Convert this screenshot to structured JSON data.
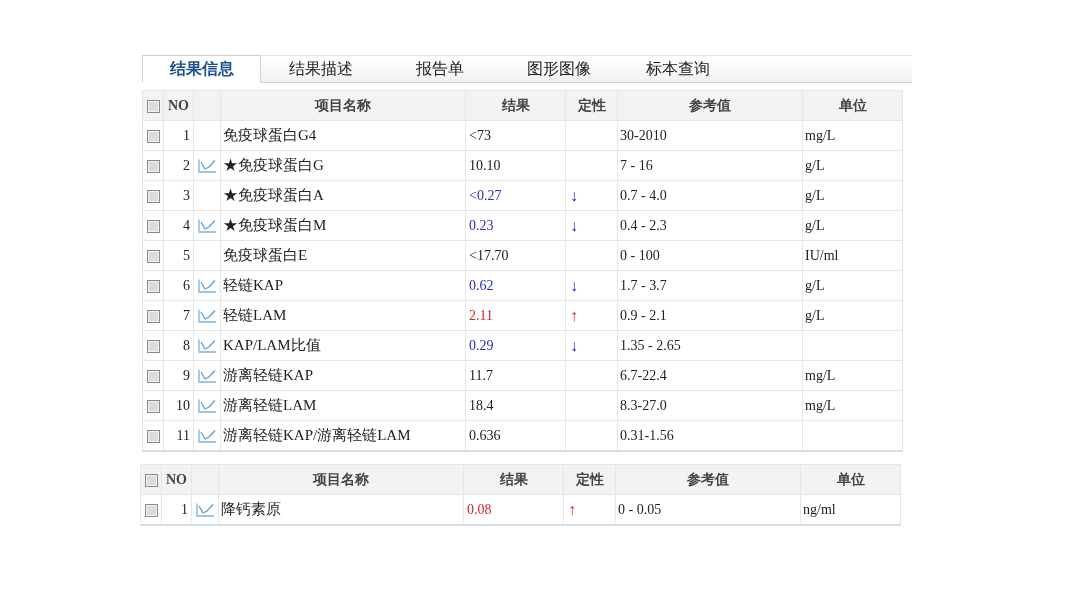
{
  "tabs": [
    {
      "label": "结果信息",
      "selected": true
    },
    {
      "label": "结果描述",
      "selected": false
    },
    {
      "label": "报告单",
      "selected": false
    },
    {
      "label": "图形图像",
      "selected": false
    },
    {
      "label": "标本查询",
      "selected": false
    }
  ],
  "tables": [
    {
      "header_checked": false,
      "columns": [
        "NO",
        "项目名称",
        "结果",
        "定性",
        "参考值",
        "单位"
      ],
      "rows": [
        {
          "checked": false,
          "no": "1",
          "trend_icon": false,
          "name": "免疫球蛋白G4",
          "result": "<73",
          "low": false,
          "high": false,
          "reference": "30-2010",
          "unit": "mg/L"
        },
        {
          "checked": false,
          "no": "2",
          "trend_icon": true,
          "name": "★免疫球蛋白G",
          "result": "10.10",
          "low": false,
          "high": false,
          "reference": "7 - 16",
          "unit": "g/L"
        },
        {
          "checked": false,
          "no": "3",
          "trend_icon": false,
          "name": "★免疫球蛋白A",
          "result": "<0.27",
          "low": true,
          "high": false,
          "flag": "↓",
          "reference": "0.7 - 4.0",
          "unit": "g/L"
        },
        {
          "checked": false,
          "no": "4",
          "trend_icon": true,
          "name": "★免疫球蛋白M",
          "result": "0.23",
          "low": true,
          "high": false,
          "flag": "↓",
          "reference": "0.4 - 2.3",
          "unit": "g/L"
        },
        {
          "checked": false,
          "no": "5",
          "trend_icon": false,
          "name": "免疫球蛋白E",
          "result": "<17.70",
          "low": false,
          "high": false,
          "reference": "0 - 100",
          "unit": "IU/ml"
        },
        {
          "checked": false,
          "no": "6",
          "trend_icon": true,
          "name": "轻链KAP",
          "result": "0.62",
          "low": true,
          "high": false,
          "flag": "↓",
          "reference": "1.7 - 3.7",
          "unit": "g/L"
        },
        {
          "checked": false,
          "no": "7",
          "trend_icon": true,
          "name": "轻链LAM",
          "result": "2.11",
          "low": false,
          "high": true,
          "flag": "↑",
          "reference": "0.9 - 2.1",
          "unit": "g/L"
        },
        {
          "checked": false,
          "no": "8",
          "trend_icon": true,
          "name": "KAP/LAM比值",
          "result": "0.29",
          "low": true,
          "high": false,
          "flag": "↓",
          "reference": "1.35 - 2.65"
        },
        {
          "checked": false,
          "no": "9",
          "trend_icon": true,
          "name": "游离轻链KAP",
          "result": "11.7",
          "low": false,
          "high": false,
          "reference": "6.7-22.4",
          "unit": "mg/L"
        },
        {
          "checked": false,
          "no": "10",
          "trend_icon": true,
          "name": "游离轻链LAM",
          "result": "18.4",
          "low": false,
          "high": false,
          "reference": "8.3-27.0",
          "unit": "mg/L"
        },
        {
          "checked": false,
          "no": "11",
          "trend_icon": true,
          "name": "游离轻链KAP/游离轻链LAM",
          "result": "0.636",
          "low": false,
          "high": false,
          "reference": "0.31-1.56"
        }
      ]
    },
    {
      "header_checked": false,
      "columns": [
        "NO",
        "项目名称",
        "结果",
        "定性",
        "参考值",
        "单位"
      ],
      "rows": [
        {
          "checked": false,
          "no": "1",
          "trend_icon": true,
          "name": "降钙素原",
          "result": "0.08",
          "low": false,
          "high": true,
          "flag": "↑",
          "reference": "0 - 0.05",
          "unit": "ng/ml"
        }
      ]
    }
  ]
}
